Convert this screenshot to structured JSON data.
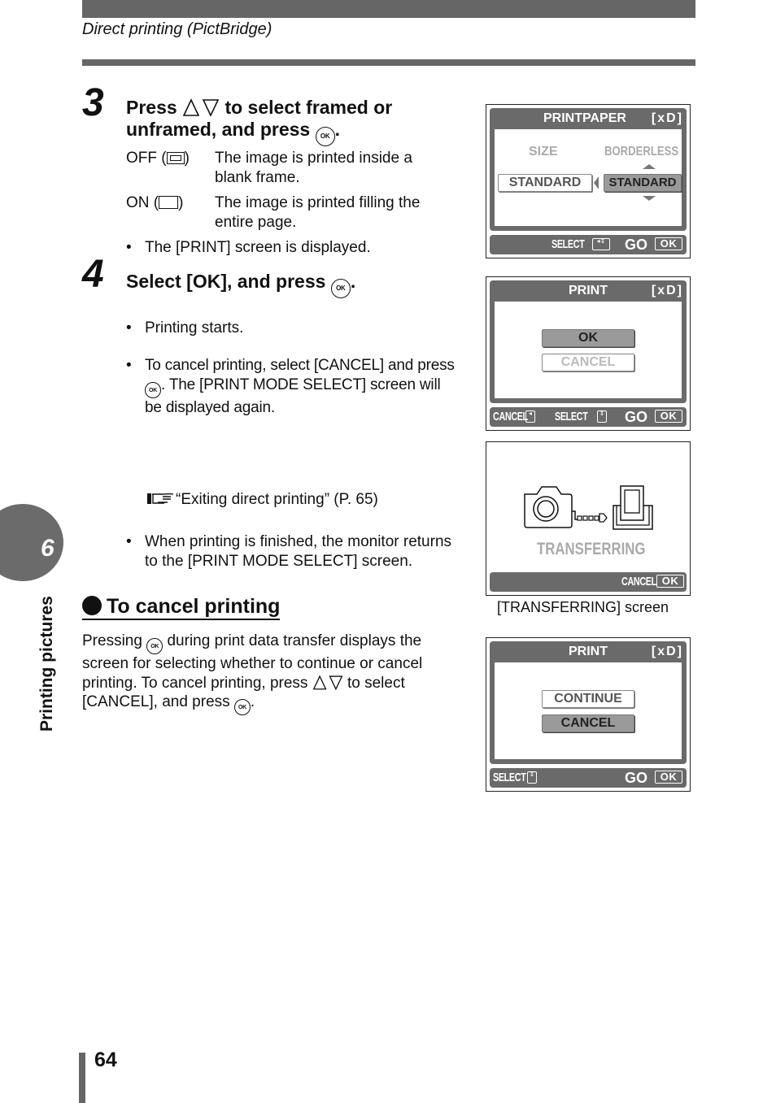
{
  "header": {
    "section_title": "Direct printing (PictBridge)"
  },
  "chapter_tab": {
    "number": "6",
    "label": "Printing pictures"
  },
  "steps": [
    {
      "number": "3",
      "heading_pre": "Press",
      "heading_mid": "to select framed or",
      "heading_line2": "unframed, and press",
      "heading_end": ".",
      "options": [
        {
          "key": "OFF (",
          "key_end": ")",
          "icon": "framed-icon",
          "desc": "The image is printed inside a blank frame."
        },
        {
          "key": "ON (",
          "key_end": ")",
          "icon": "unframed-icon",
          "desc": "The image is printed filling the entire page."
        }
      ],
      "bullets": [
        "The [PRINT] screen is displayed."
      ]
    },
    {
      "number": "4",
      "heading": "Select [OK], and press",
      "heading_end": ".",
      "bullets": [
        "Printing starts.",
        "To cancel printing, select [CANCEL] and",
        "When printing is finished, the monitor returns to the [PRINT MODE SELECT] screen."
      ],
      "bullet2_pre_icon": "press",
      "bullet2_post_icon": ". The [PRINT MODE SELECT] screen will be displayed again.",
      "reference": "“Exiting direct printing” (P. 65)"
    }
  ],
  "cancel_section": {
    "title": "To cancel printing",
    "text_1": "Pressing",
    "text_2": "during print data transfer displays the screen for selecting whether to continue or cancel printing. To cancel printing, press",
    "text_3": "to select [CANCEL], and press",
    "text_4": "."
  },
  "screens": {
    "printpaper": {
      "title": "PRINTPAPER",
      "media": "[xD]",
      "size_label": "SIZE",
      "borderless_label": "BORDERLESS",
      "size_value": "STANDARD",
      "borderless_value": "STANDARD",
      "foot_select": "SELECT",
      "foot_go": "GO",
      "foot_ok": "OK"
    },
    "print_ok": {
      "title": "PRINT",
      "media": "[xD]",
      "options": [
        "OK",
        "CANCEL"
      ],
      "selected": "OK",
      "foot_cancel": "CANCEL",
      "foot_select": "SELECT",
      "foot_go": "GO",
      "foot_ok": "OK"
    },
    "transferring": {
      "status": "TRANSFERRING",
      "foot_cancel": "CANCEL",
      "foot_ok": "OK",
      "caption": "[TRANSFERRING] screen"
    },
    "print_continue": {
      "title": "PRINT",
      "media": "[xD]",
      "options": [
        "CONTINUE",
        "CANCEL"
      ],
      "selected": "CANCEL",
      "foot_select": "SELECT",
      "foot_go": "GO",
      "foot_ok": "OK"
    }
  },
  "footer": {
    "page_number": "64"
  }
}
